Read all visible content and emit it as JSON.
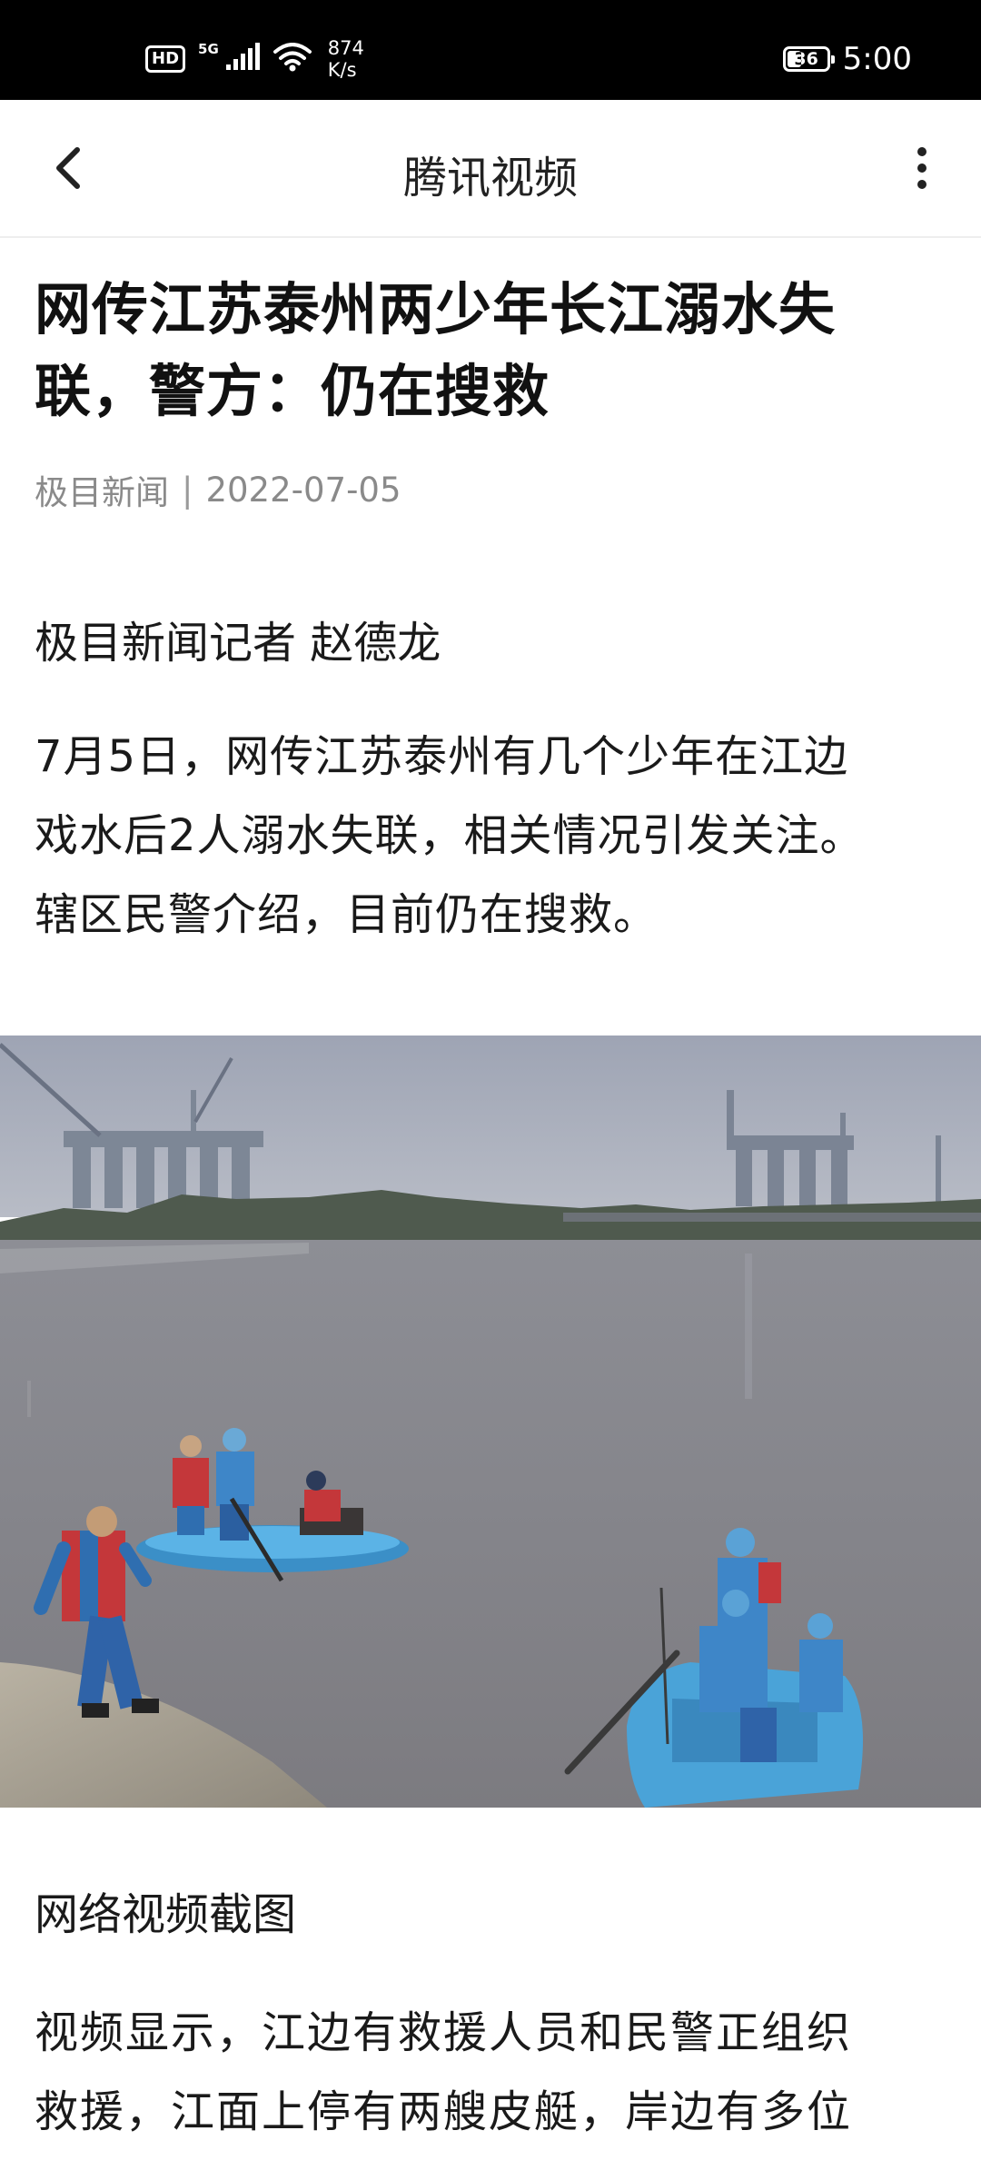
{
  "status_bar": {
    "hd": "HD",
    "network": "5G",
    "speed_value": "874",
    "speed_unit": "K/s",
    "battery": "36",
    "battery_level_percent": 36,
    "time": "5:00"
  },
  "nav": {
    "title": "腾讯视频",
    "back_icon": "chevron-left-icon",
    "more_icon": "more-vertical-icon"
  },
  "article": {
    "headline_line1": "网传江苏泰州两少年长江溺水失",
    "headline_line2": "联，警方：仍在搜救",
    "source": "极目新闻",
    "separator": "|",
    "date": "2022-07-05",
    "byline": "极目新闻记者 赵德龙",
    "para1_line1": "7月5日，网传江苏泰州有几个少年在江边",
    "para1_line2": "戏水后2人溺水失联，相关情况引发关注。",
    "para1_line3": "辖区民警介绍，目前仍在搜救。",
    "photo_caption": "网络视频截图",
    "para2_line1": "视频显示，江边有救援人员和民警正组织",
    "para2_line2": "救援，江面上停有两艘皮艇，岸边有多位"
  },
  "colors": {
    "status_bar_bg": "#000000",
    "text": "#1a1a1a",
    "meta": "#8a8a8a",
    "water": "#8e8e94",
    "boat": "#4aa3d8"
  }
}
